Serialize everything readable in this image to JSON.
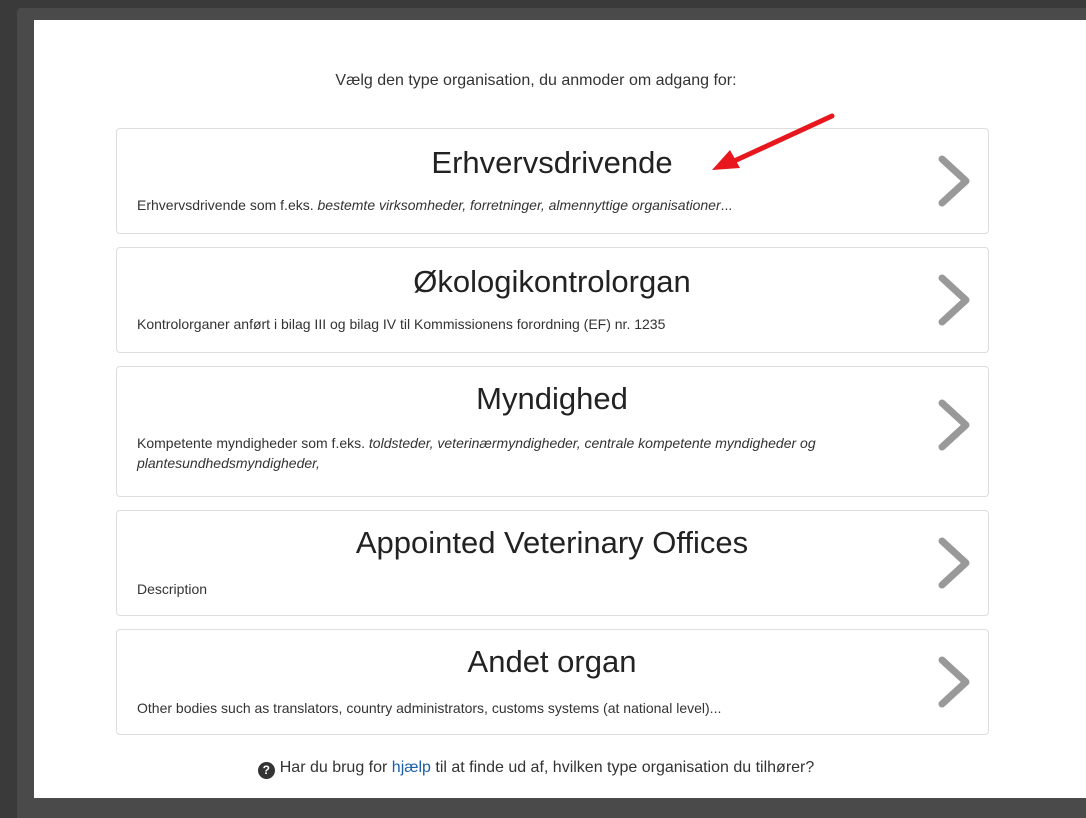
{
  "heading": "Vælg den type organisation, du anmoder om adgang for:",
  "cards": [
    {
      "title": "Erhvervsdrivende",
      "desc_plain": "Erhvervsdrivende som f.eks. ",
      "desc_italic": "bestemte virksomheder, forretninger, almennyttige organisationer",
      "desc_tail": "..."
    },
    {
      "title": "Økologikontrolorgan",
      "desc_plain": "Kontrolorganer anført i bilag III og bilag IV til Kommissionens forordning (EF) nr. 1235",
      "desc_italic": "",
      "desc_tail": ""
    },
    {
      "title": "Myndighed",
      "desc_plain": "Kompetente myndigheder som f.eks. ",
      "desc_italic": "toldsteder, veterinærmyndigheder, centrale kompetente myndigheder og plantesundhedsmyndigheder,",
      "desc_tail": ""
    },
    {
      "title": "Appointed Veterinary Offices",
      "desc_plain": "Description",
      "desc_italic": "",
      "desc_tail": ""
    },
    {
      "title": "Andet organ",
      "desc_plain": "Other bodies such as translators, country administrators, customs systems (at national level)...",
      "desc_italic": "",
      "desc_tail": ""
    }
  ],
  "footer": {
    "icon": "question-circle-icon",
    "before": "Har du brug for ",
    "link": "hjælp",
    "after": " til at finde ud af, hvilken type organisation du tilhører?"
  },
  "colors": {
    "link": "#1a5fa8",
    "annotation_arrow": "#e8161d",
    "chevron": "#999999"
  }
}
